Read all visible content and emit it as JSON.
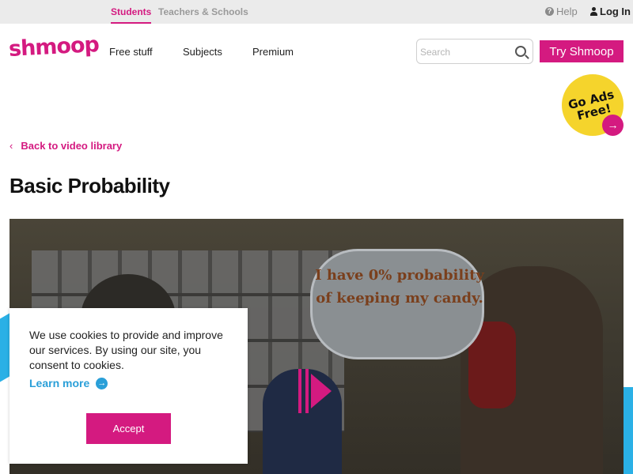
{
  "topbar": {
    "tabs": [
      {
        "label": "Students",
        "active": true
      },
      {
        "label": "Teachers & Schools",
        "active": false
      }
    ],
    "help_label": "Help",
    "login_label": "Log In"
  },
  "header": {
    "logo_text": "shmoop",
    "nav": [
      "Free stuff",
      "Subjects",
      "Premium"
    ],
    "search_placeholder": "Search",
    "try_label": "Try Shmoop"
  },
  "ads_badge": {
    "text": "Go Ads Free!",
    "arrow": "→"
  },
  "back_link": {
    "chevron": "‹",
    "label": "Back to video library"
  },
  "page_title": "Basic Probability",
  "video": {
    "bubble_text": "I have 0% probability of keeping my candy."
  },
  "cookie": {
    "text": "We use cookies to provide and improve our services. By using our site, you consent to cookies.",
    "learn_more": "Learn more",
    "accept_label": "Accept"
  },
  "colors": {
    "brand": "#d41a80",
    "accent_blue": "#2a9fd8",
    "badge_yellow": "#f5d42c"
  },
  "icons": [
    "help-icon",
    "user-icon",
    "search-icon",
    "arrow-right-icon",
    "chevron-left-icon",
    "play-icon"
  ]
}
